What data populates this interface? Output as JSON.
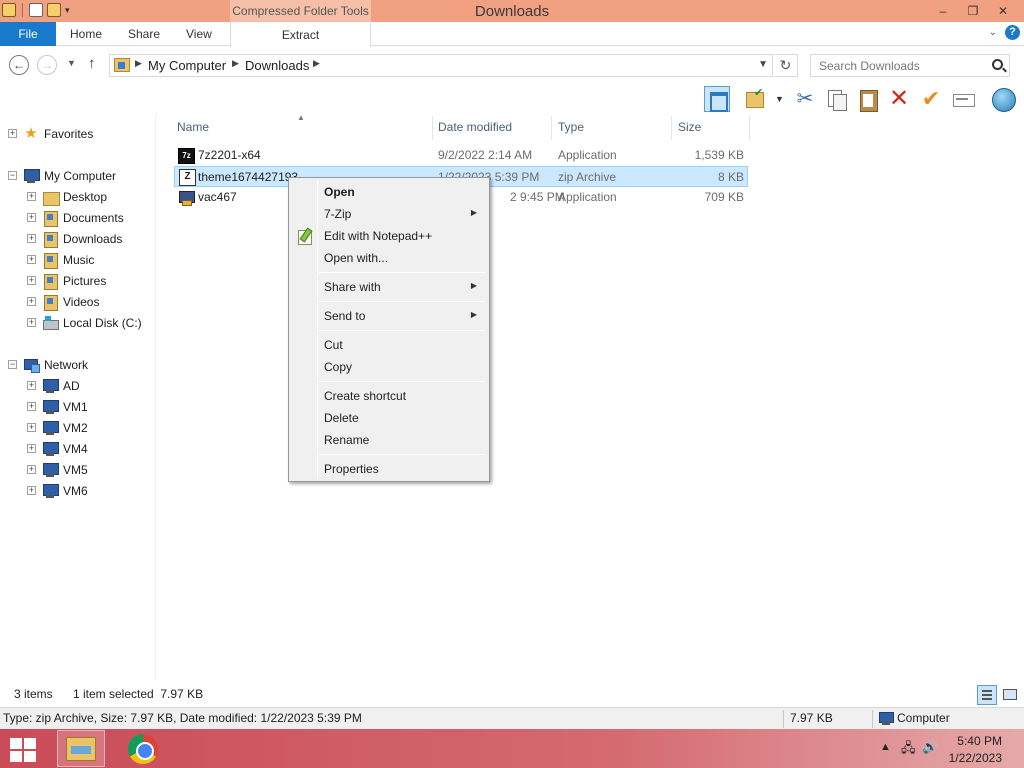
{
  "window": {
    "title": "Downloads",
    "contextual_tab_group": "Compressed Folder Tools",
    "controls": {
      "minimize": "–",
      "restore": "❐",
      "close": "✕"
    }
  },
  "ribbon": {
    "tabs": [
      {
        "label": "File",
        "active": true
      },
      {
        "label": "Home"
      },
      {
        "label": "Share"
      },
      {
        "label": "View"
      },
      {
        "label": "Extract"
      }
    ],
    "help_icon": "?",
    "collapse_icon": "⌄"
  },
  "address": {
    "crumbs": [
      "My Computer",
      "Downloads"
    ],
    "search_placeholder": "Search Downloads"
  },
  "toolbar": {
    "icons": [
      "layout-icon",
      "folder-check-icon",
      "cut-icon",
      "copy-icon",
      "paste-icon",
      "delete-icon",
      "checkmark-icon",
      "rename-icon",
      "globe-icon"
    ]
  },
  "nav": {
    "favorites": "Favorites",
    "my_computer": "My Computer",
    "computer_children": [
      "Desktop",
      "Documents",
      "Downloads",
      "Music",
      "Pictures",
      "Videos",
      "Local Disk (C:)"
    ],
    "network": "Network",
    "network_children": [
      "AD",
      "VM1",
      "VM2",
      "VM4",
      "VM5",
      "VM6"
    ],
    "selected": "Downloads"
  },
  "columns": {
    "name": "Name",
    "date": "Date modified",
    "type": "Type",
    "size": "Size"
  },
  "files": [
    {
      "name": "7z2201-x64",
      "date": "9/2/2022 2:14 AM",
      "type": "Application",
      "size": "1,539 KB",
      "icon": "7z-icon"
    },
    {
      "name": "theme1674427193",
      "date": "1/22/2023 5:39 PM",
      "type": "zip Archive",
      "size": "8 KB",
      "icon": "zip-icon",
      "selected": true
    },
    {
      "name": "vac467",
      "date": "2 9:45 PM",
      "type": "Application",
      "size": "709 KB",
      "icon": "app-icon"
    }
  ],
  "context_menu": {
    "items": [
      {
        "label": "Open",
        "bold": true
      },
      {
        "label": "7-Zip",
        "submenu": true
      },
      {
        "label": "Edit with Notepad++",
        "icon": "notepad-plus-plus-icon"
      },
      {
        "label": "Open with..."
      },
      {
        "label": "Share with",
        "submenu": true
      },
      {
        "label": "Send to",
        "submenu": true
      },
      {
        "label": "Cut"
      },
      {
        "label": "Copy"
      },
      {
        "label": "Create shortcut"
      },
      {
        "label": "Delete"
      },
      {
        "label": "Rename"
      },
      {
        "label": "Properties"
      }
    ],
    "submenu_arrow": "▶"
  },
  "status": {
    "item_count": "3 items",
    "selection": "1 item selected  7.97 KB",
    "details": "Type: zip Archive, Size: 7.97 KB, Date modified: 1/22/2023 5:39 PM",
    "size": "7.97 KB",
    "location": "Computer"
  },
  "taskbar": {
    "time": "5:40 PM",
    "date": "1/22/2023",
    "tray_arrow": "▲",
    "apps": [
      "file-explorer",
      "chrome"
    ]
  },
  "colors": {
    "titlebar": "#f1a081",
    "file_tab": "#1979ca",
    "selection": "#cce8ff",
    "taskbar": "#c94b57"
  }
}
